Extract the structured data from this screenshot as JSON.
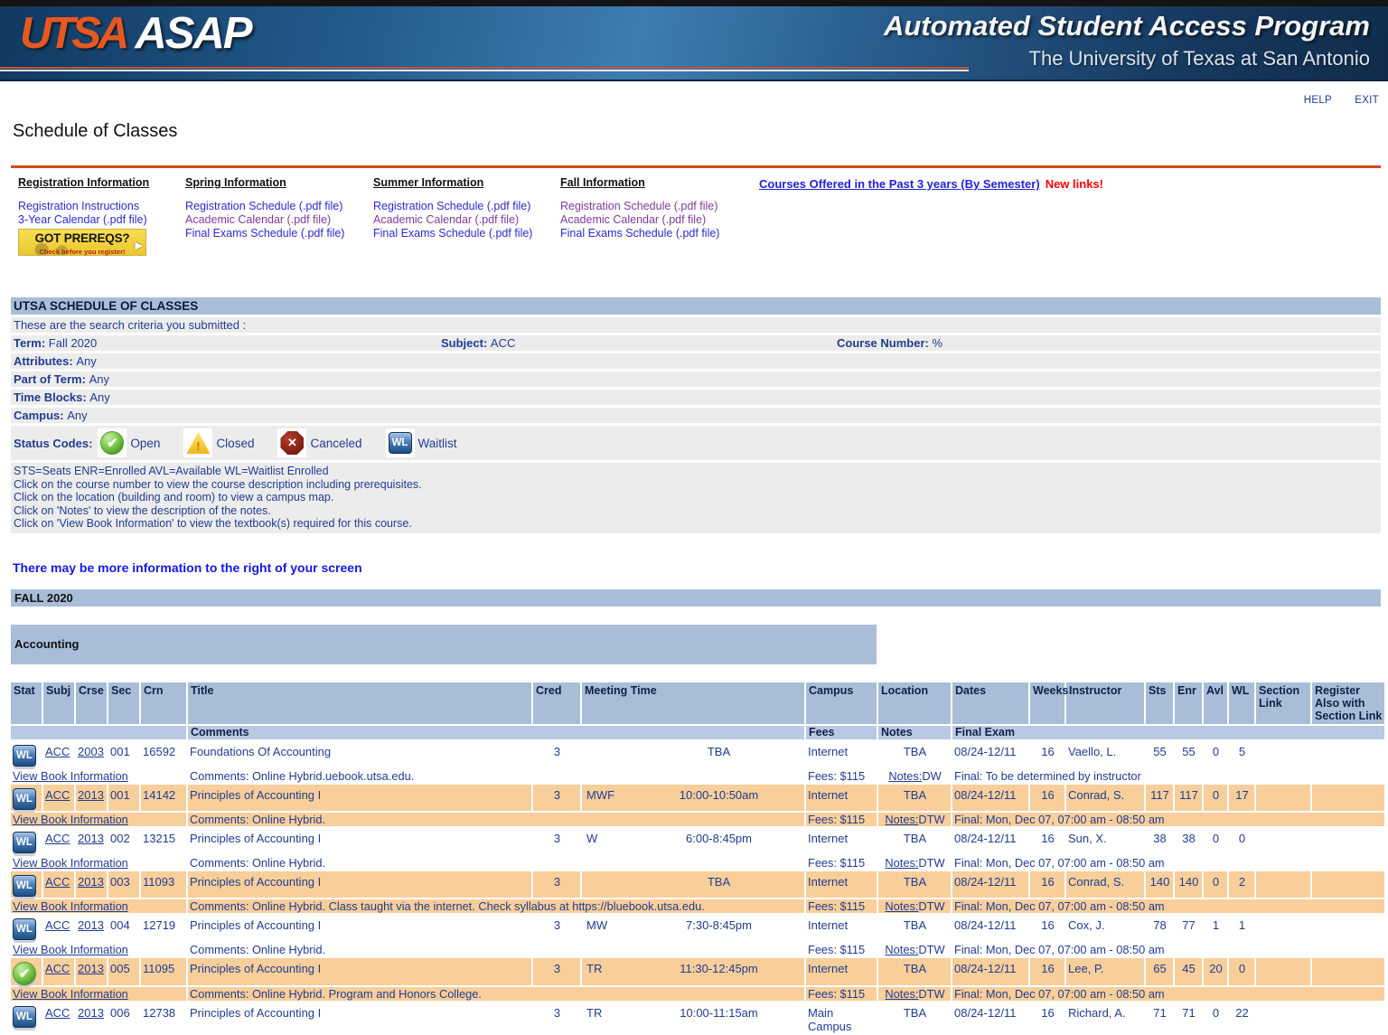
{
  "header": {
    "logo_utsa": "UTSA",
    "logo_asap": "ASAP",
    "title": "Automated Student Access Program",
    "subtitle": "The University of Texas at San Antonio"
  },
  "topnav": {
    "help": "HELP",
    "exit": "EXIT"
  },
  "page_title": "Schedule of Classes",
  "nav_columns": [
    {
      "heading": "Registration Information",
      "links": [
        {
          "label": "Registration Instructions",
          "visited": false
        },
        {
          "label": "3-Year Calendar (.pdf file)",
          "visited": false
        }
      ],
      "banner": {
        "title": "GOT PREREQS?",
        "subtitle": "Check before you register!"
      }
    },
    {
      "heading": "Spring Information",
      "links": [
        {
          "label": "Registration Schedule (.pdf file)",
          "visited": false
        },
        {
          "label": "Academic Calendar (.pdf file)",
          "visited": true
        },
        {
          "label": "Final Exams Schedule (.pdf file)",
          "visited": false
        }
      ]
    },
    {
      "heading": "Summer Information",
      "links": [
        {
          "label": "Registration Schedule (.pdf file)",
          "visited": false
        },
        {
          "label": "Academic Calendar (.pdf file)",
          "visited": true
        },
        {
          "label": "Final Exams Schedule (.pdf file)",
          "visited": false
        }
      ]
    },
    {
      "heading": "Fall Information",
      "links": [
        {
          "label": "Registration Schedule (.pdf file)",
          "visited": true
        },
        {
          "label": "Academic Calendar (.pdf file)",
          "visited": true
        },
        {
          "label": "Final Exams Schedule (.pdf file)",
          "visited": false
        }
      ]
    }
  ],
  "right_link": {
    "label": "Courses Offered in the Past 3 years (By Semester)",
    "new_label": "New links!"
  },
  "criteria": {
    "header": "UTSA SCHEDULE OF CLASSES",
    "intro": "These are the search criteria you submitted :",
    "term_label": "Term:",
    "term": "Fall 2020",
    "subject_label": "Subject:",
    "subject": "ACC",
    "course_number_label": "Course Number:",
    "course_number": "%",
    "attributes_label": "Attributes:",
    "attributes": "Any",
    "part_of_term_label": "Part of Term:",
    "part_of_term": "Any",
    "time_blocks_label": "Time Blocks:",
    "time_blocks": "Any",
    "campus_label": "Campus:",
    "campus": "Any",
    "status_codes_label": "Status Codes:",
    "status_codes": [
      {
        "icon": "open",
        "label": "Open"
      },
      {
        "icon": "closed",
        "label": "Closed"
      },
      {
        "icon": "canceled",
        "label": "Canceled"
      },
      {
        "icon": "waitlist",
        "label": "Waitlist"
      }
    ],
    "legend": [
      "STS=Seats ENR=Enrolled AVL=Available WL=Waitlist Enrolled",
      "Click on the course number to view the course description including prerequisites.",
      "Click on the location (building and room) to view a campus map.",
      "Click on 'Notes' to view the description of the notes.",
      "Click on 'View Book Information' to view the textbook(s) required for this course."
    ]
  },
  "notice": "There may be more information to the right of your screen",
  "term_bar": "FALL 2020",
  "subject_bar": "Accounting",
  "table": {
    "columns": [
      "Stat",
      "Subj",
      "Crse",
      "Sec",
      "Crn",
      "Title",
      "Cred",
      "Meeting Time",
      "Campus",
      "Location",
      "Dates",
      "Weeks",
      "Instructor",
      "Sts",
      "Enr",
      "Avl",
      "WL",
      "Section Link",
      "Register Also with Section Link"
    ],
    "subheaders": {
      "comments": "Comments",
      "fees": "Fees",
      "notes": "Notes",
      "final_exam": "Final Exam"
    },
    "view_book_label": "View Book Information",
    "notes_label": "Notes:",
    "rows": [
      {
        "stat": "waitlist",
        "subj": "ACC",
        "crse": "2003",
        "sec": "001",
        "crn": "16592",
        "title": "Foundations Of Accounting",
        "cred": "3",
        "days": "",
        "time": "TBA",
        "campus": "Internet",
        "location": "TBA",
        "dates": "08/24-12/11",
        "weeks": "16",
        "instructor": "Vaello, L.",
        "sts": "55",
        "enr": "55",
        "avl": "0",
        "wl": "5",
        "full": true,
        "shaded": false,
        "book": {
          "comments": "Comments: Online Hybrid.uebook.utsa.edu.",
          "fees": "Fees: $115",
          "notes": "DW",
          "final": "Final: To be determined by instructor"
        }
      },
      {
        "stat": "waitlist",
        "subj": "ACC",
        "crse": "2013",
        "sec": "001",
        "crn": "14142",
        "title": "Principles of Accounting I",
        "cred": "3",
        "days": "MWF",
        "time": "10:00-10:50am",
        "campus": "Internet",
        "location": "TBA",
        "dates": "08/24-12/11",
        "weeks": "16",
        "instructor": "Conrad, S.",
        "sts": "117",
        "enr": "117",
        "avl": "0",
        "wl": "17",
        "full": true,
        "shaded": true,
        "book": {
          "comments": "Comments: Online Hybrid.",
          "fees": "Fees: $115",
          "notes": "DTW",
          "final": "Final: Mon, Dec 07, 07:00 am - 08:50 am"
        }
      },
      {
        "stat": "waitlist",
        "subj": "ACC",
        "crse": "2013",
        "sec": "002",
        "crn": "13215",
        "title": "Principles of Accounting I",
        "cred": "3",
        "days": "W",
        "time": "6:00-8:45pm",
        "campus": "Internet",
        "location": "TBA",
        "dates": "08/24-12/11",
        "weeks": "16",
        "instructor": "Sun, X.",
        "sts": "38",
        "enr": "38",
        "avl": "0",
        "wl": "0",
        "full": true,
        "shaded": false,
        "book": {
          "comments": "Comments: Online Hybrid.",
          "fees": "Fees: $115",
          "notes": "DTW",
          "final": "Final: Mon, Dec 07, 07:00 am - 08:50 am"
        }
      },
      {
        "stat": "waitlist",
        "subj": "ACC",
        "crse": "2013",
        "sec": "003",
        "crn": "11093",
        "title": "Principles of Accounting I",
        "cred": "3",
        "days": "",
        "time": "TBA",
        "campus": "Internet",
        "location": "TBA",
        "dates": "08/24-12/11",
        "weeks": "16",
        "instructor": "Conrad, S.",
        "sts": "140",
        "enr": "140",
        "avl": "0",
        "wl": "2",
        "full": true,
        "shaded": true,
        "book": {
          "comments": "Comments: Online Hybrid. Class taught via the internet. Check syllabus at https://bluebook.utsa.edu.",
          "fees": "Fees: $115",
          "notes": "DTW",
          "final": "Final: Mon, Dec 07, 07:00 am - 08:50 am"
        }
      },
      {
        "stat": "waitlist",
        "subj": "ACC",
        "crse": "2013",
        "sec": "004",
        "crn": "12719",
        "title": "Principles of Accounting I",
        "cred": "3",
        "days": "MW",
        "time": "7:30-8:45pm",
        "campus": "Internet",
        "location": "TBA",
        "dates": "08/24-12/11",
        "weeks": "16",
        "instructor": "Cox, J.",
        "sts": "78",
        "enr": "77",
        "avl": "1",
        "wl": "1",
        "full": false,
        "shaded": false,
        "book": {
          "comments": "Comments: Online Hybrid.",
          "fees": "Fees: $115",
          "notes": "DTW",
          "final": "Final: Mon, Dec 07, 07:00 am - 08:50 am"
        }
      },
      {
        "stat": "open",
        "subj": "ACC",
        "crse": "2013",
        "sec": "005",
        "crn": "11095",
        "title": "Principles of Accounting I",
        "cred": "3",
        "days": "TR",
        "time": "11:30-12:45pm",
        "campus": "Internet",
        "location": "TBA",
        "dates": "08/24-12/11",
        "weeks": "16",
        "instructor": "Lee, P.",
        "sts": "65",
        "enr": "45",
        "avl": "20",
        "wl": "0",
        "full": false,
        "shaded": true,
        "book": {
          "comments": "Comments: Online Hybrid. Program and Honors College.",
          "fees": "Fees: $115",
          "notes": "DTW",
          "final": "Final: Mon, Dec 07, 07:00 am - 08:50 am"
        }
      },
      {
        "stat": "waitlist",
        "subj": "ACC",
        "crse": "2013",
        "sec": "006",
        "crn": "12738",
        "title": "Principles of Accounting I",
        "cred": "3",
        "days": "TR",
        "time": "10:00-11:15am",
        "campus": "Main Campus",
        "location": "TBA",
        "dates": "08/24-12/11",
        "weeks": "16",
        "instructor": "Richard, A.",
        "sts": "71",
        "enr": "71",
        "avl": "0",
        "wl": "22",
        "full": true,
        "shaded": false,
        "book": null
      }
    ]
  },
  "colors": {
    "accent_orange": "#cf4a1e",
    "bar_blue": "#a9bdd9",
    "row_orange": "#f8ce9b",
    "navy_text": "#223c8f",
    "alert_red": "#ee3b1c"
  }
}
